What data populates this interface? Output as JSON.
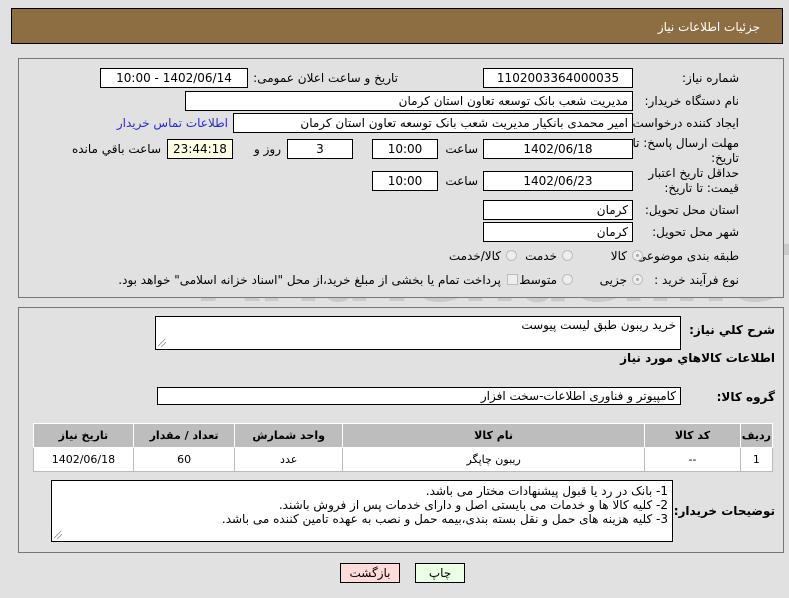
{
  "header": {
    "title": "جزئیات اطلاعات نیاز"
  },
  "form": {
    "need_number": {
      "label": "شماره نیاز:",
      "value": "1102003364000035"
    },
    "announce_datetime": {
      "label": "تاریخ و ساعت اعلان عمومی:",
      "value": "1402/06/14 - 10:00"
    },
    "buyer_org": {
      "label": "نام دستگاه خریدار:",
      "value": "مدیریت شعب بانک توسعه تعاون استان کرمان"
    },
    "requester": {
      "label": "ایجاد کننده درخواست:",
      "value": "امیر محمدی بانکیار مدیریت شعب بانک توسعه تعاون استان کرمان",
      "contact_link": "اطلاعات تماس خریدار"
    },
    "reply_deadline": {
      "label": "مهلت ارسال پاسخ: تا تاریخ:",
      "date": "1402/06/18",
      "time_label": "ساعت",
      "time": "10:00",
      "days": "3",
      "days_label": "روز و",
      "remaining": "23:44:18",
      "remaining_label": "ساعت باقي مانده"
    },
    "price_validity": {
      "label": "حداقل تاریخ اعتبار قیمت: تا تاریخ:",
      "date": "1402/06/23",
      "time_label": "ساعت",
      "time": "10:00"
    },
    "delivery_province": {
      "label": "استان محل تحویل:",
      "value": "کرمان"
    },
    "delivery_city": {
      "label": "شهر محل تحویل:",
      "value": "کرمان"
    },
    "category": {
      "label": "طبقه بندی موضوعی:",
      "options": [
        "کالا",
        "خدمت",
        "کالا/خدمت"
      ],
      "selected": "کالا"
    },
    "purchase_type": {
      "label": "نوع فرآیند خرید :",
      "options": [
        "جزیی",
        "متوسط"
      ],
      "selected": "جزیی",
      "payment_note": "پرداخت تمام یا بخشی از مبلغ خرید،از محل \"اسناد خزانه اسلامی\" خواهد بود."
    }
  },
  "details": {
    "general_desc": {
      "label": "شرح کلي نياز:",
      "value": "خرید ریبون طبق لیست پیوست"
    },
    "goods_info_title": "اطلاعات کالاهاي مورد نياز",
    "goods_group": {
      "label": "گروه کالا:",
      "value": "کامپیوتر و فناوری اطلاعات-سخت افزار"
    },
    "table": {
      "headers": [
        "ردیف",
        "کد کالا",
        "نام کالا",
        "واحد شمارش",
        "تعداد / مقدار",
        "تاریخ نیاز"
      ],
      "rows": [
        [
          "1",
          "--",
          "ریبون چاپگر",
          "عدد",
          "60",
          "1402/06/18"
        ]
      ]
    },
    "buyer_notes": {
      "label": "توضیحات خریدار:",
      "lines": [
        "1- بانک در رد یا قبول پیشنهادات مختار می باشد.",
        "2- کلیه کالا ها و خدمات می بایستی اصل و دارای خدمات پس از فروش باشند.",
        "3- کلیه هزینه های حمل و نقل بسته بندی،بیمه حمل و نصب  به عهده تامین کننده می باشد."
      ]
    }
  },
  "buttons": {
    "print": "چاپ",
    "back": "بازگشت"
  },
  "watermark": "AriaTender.neT"
}
